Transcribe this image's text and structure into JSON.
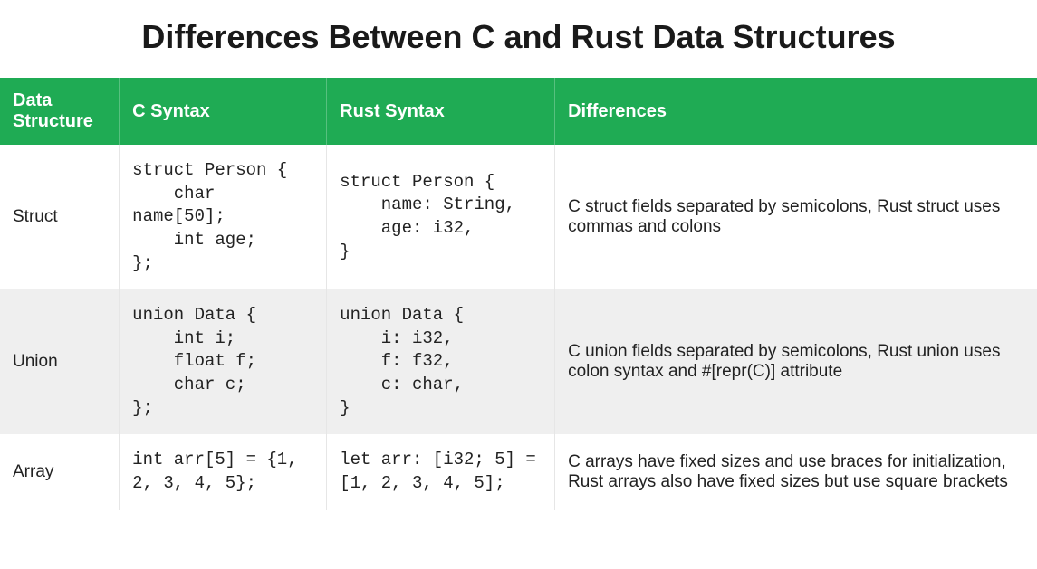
{
  "title": "Differences Between C and Rust Data Structures",
  "headers": [
    "Data Structure",
    "C Syntax",
    "Rust Syntax",
    "Differences"
  ],
  "rows": [
    {
      "name": "Struct",
      "c_syntax": "struct Person {\n    char name[50];\n    int age;\n};",
      "rust_syntax": "struct Person {\n    name: String,\n    age: i32,\n}",
      "differences": "C struct fields separated by semicolons, Rust struct uses commas and colons"
    },
    {
      "name": "Union",
      "c_syntax": "union Data {\n    int i;\n    float f;\n    char c;\n};",
      "rust_syntax": "union Data {\n    i: i32,\n    f: f32,\n    c: char,\n}",
      "differences": "C union fields separated by semicolons, Rust union uses colon syntax and #[repr(C)] attribute"
    },
    {
      "name": "Array",
      "c_syntax": "int arr[5] = {1, 2, 3, 4, 5};",
      "rust_syntax": "let arr: [i32; 5] = [1, 2, 3, 4, 5];",
      "differences": "C arrays have fixed sizes and use braces for initialization, Rust arrays also have fixed sizes but use square brackets"
    }
  ]
}
